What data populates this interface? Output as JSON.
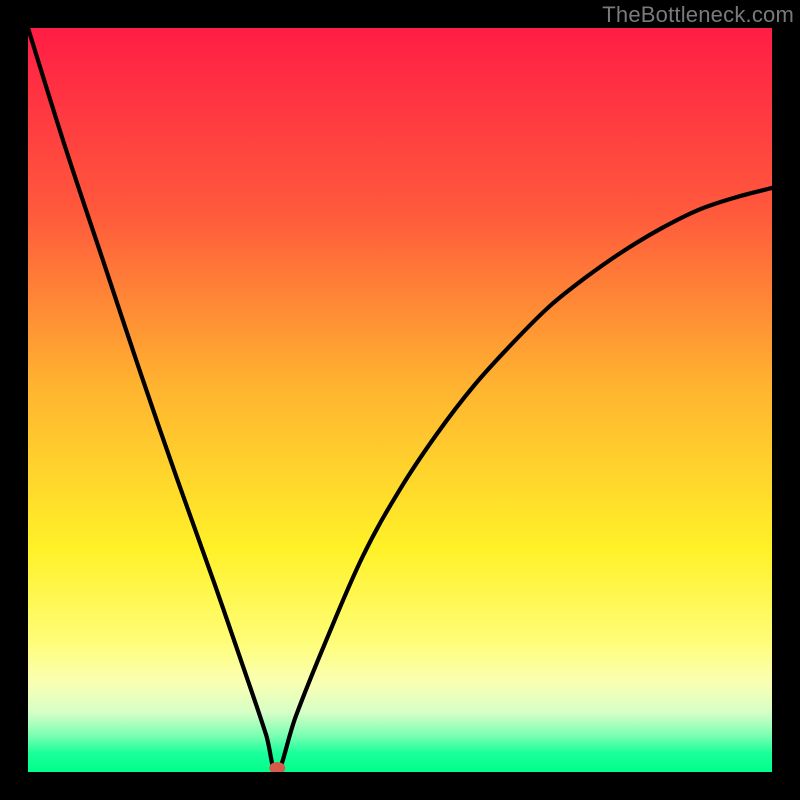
{
  "watermark": {
    "text": "TheBottleneck.com"
  },
  "chart_data": {
    "type": "line",
    "title": "",
    "xlabel": "",
    "ylabel": "",
    "xlim": [
      0,
      1
    ],
    "ylim": [
      0,
      1
    ],
    "grid": false,
    "legend": false,
    "background_gradient": [
      {
        "stop": 0.0,
        "color": "#ff1d45"
      },
      {
        "stop": 0.25,
        "color": "#ff5a3c"
      },
      {
        "stop": 0.48,
        "color": "#ffb330"
      },
      {
        "stop": 0.7,
        "color": "#fff128"
      },
      {
        "stop": 0.82,
        "color": "#fffd74"
      },
      {
        "stop": 0.88,
        "color": "#faffb3"
      },
      {
        "stop": 0.92,
        "color": "#d6ffc6"
      },
      {
        "stop": 0.95,
        "color": "#7effb3"
      },
      {
        "stop": 0.975,
        "color": "#19ff9a"
      },
      {
        "stop": 1.0,
        "color": "#00ff8c"
      }
    ],
    "vertex_x": 0.335,
    "marker": {
      "x": 0.335,
      "y": 0.0,
      "color": "#d55a4b"
    },
    "series": [
      {
        "name": "left-branch",
        "x": [
          0.0,
          0.05,
          0.1,
          0.15,
          0.2,
          0.25,
          0.3,
          0.32,
          0.335
        ],
        "y": [
          1.0,
          0.84,
          0.69,
          0.54,
          0.395,
          0.255,
          0.11,
          0.05,
          0.0
        ]
      },
      {
        "name": "right-branch",
        "x": [
          0.335,
          0.36,
          0.4,
          0.45,
          0.5,
          0.55,
          0.6,
          0.65,
          0.7,
          0.75,
          0.8,
          0.85,
          0.9,
          0.95,
          1.0
        ],
        "y": [
          0.0,
          0.075,
          0.175,
          0.29,
          0.38,
          0.455,
          0.52,
          0.575,
          0.625,
          0.665,
          0.7,
          0.73,
          0.755,
          0.772,
          0.785
        ]
      }
    ]
  }
}
